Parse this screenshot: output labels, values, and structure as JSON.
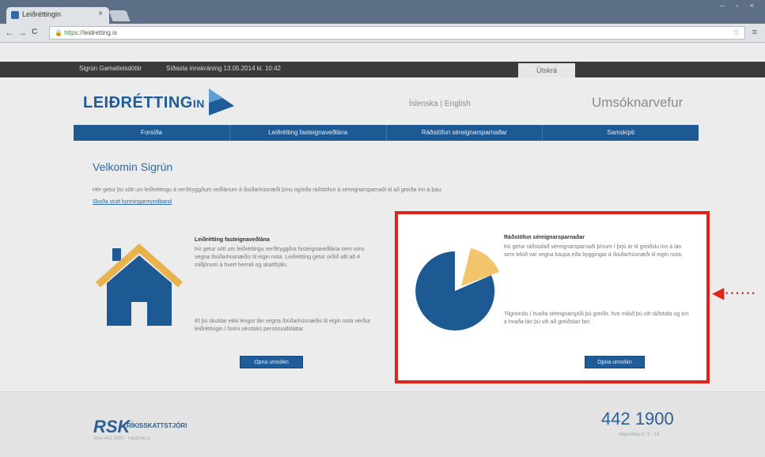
{
  "browser": {
    "tab_title": "Leiðréttingin",
    "tab_close": "×",
    "url_lock": "🔒",
    "url_scheme": "https://",
    "url_path": "leidretting.is",
    "back": "←",
    "forward": "→",
    "reload": "C",
    "star": "☆",
    "menu": "≡",
    "window_controls": "– ▫ ×"
  },
  "topbar": {
    "user": "Sigrún Gamalíelsdóttir",
    "last_login": "Síðasta innskráning 13.05.2014 kl. 10:42",
    "logout": "Útskrá"
  },
  "header": {
    "logo_main": "LEIÐRÉTTING",
    "logo_sub": "IN",
    "lang": "Íslenska | English",
    "section": "Umsóknarvefur"
  },
  "menu": [
    "Forsíða",
    "Leiðrétting fasteignaveðlána",
    "Ráðstöfun séreignarsparnaðar",
    "Samskipti"
  ],
  "main": {
    "welcome": "Velkomin Sigrún",
    "intro": "Hér getur þú sótt um leiðréttingu á verðtryggðum veðlánum á íbúðarhúsnæði þínu og/eða ráðstöfun á séreignarsparnaði til að greiða inn á þau.",
    "intro_link": "Skoða stutt kynningarmyndband"
  },
  "card_left": {
    "title": "Leiðrétting fasteignaveðlána",
    "text1": "Þú getur sótt um leiðréttingu verðtryggðra fasteignaveðlána sem voru vegna íbúðarhúsnæðis til eigin nota. Leiðrétting getur orðið allt að 4 milljónum á hvert heimili og skattfrjáls.",
    "text2": "Ef þú skuldar ekki lengur lán vegna íbúðarhúsnæðis til eigin nota verður leiðréttingin í formi sérstaks persónuafsláttar.",
    "button": "Opna umsókn"
  },
  "card_right": {
    "title": "Ráðstöfun séreignarsparnaðar",
    "text1": "Þú getur ráðstafað séreignarsparnaði þínum í þrjú ár til greiðslu inn á lán sem tekið var vegna kaupa eða byggingar á íbúðarhúsnæði til eigin nota.",
    "text2": "Tilgreindu í hvaða séreignarsjóði þú greiðir, hve mikið þú vilt ráðstafa og inn á hvaða lán þú vilt að greiðslan fari.",
    "button": "Opna umsókn"
  },
  "annotation_arrow": "◀⋯⋯",
  "footer": {
    "rsk": "RSK",
    "rsk_name": "RÍKISSKATTSTJÓRI",
    "rsk_small": "Sími 442 1000 · rsk@rsk.is",
    "phone": "442 1900",
    "phone_sub": "Afgreiðsla kl. 9 - 16"
  },
  "colors": {
    "brand": "#1f5c99",
    "highlight": "#e2231a",
    "pie_blue": "#1d5a93",
    "pie_yellow": "#f2c46b",
    "roof": "#e8b24d"
  }
}
